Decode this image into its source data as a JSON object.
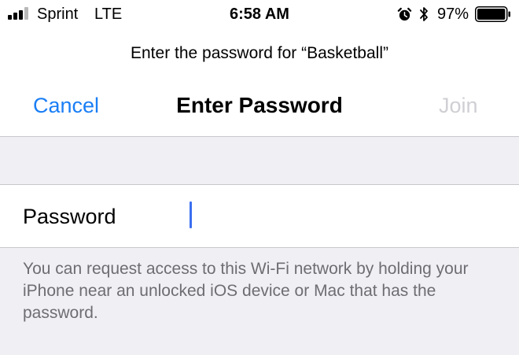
{
  "status_bar": {
    "carrier": "Sprint",
    "network": "LTE",
    "time": "6:58 AM",
    "battery_percent": "97%",
    "battery_level": 0.97,
    "icons": [
      "signal-bars-icon",
      "alarm-icon",
      "bluetooth-icon",
      "battery-icon"
    ]
  },
  "prompt": "Enter the password for “Basketball”",
  "nav": {
    "cancel_label": "Cancel",
    "title": "Enter Password",
    "join_label": "Join"
  },
  "password_field": {
    "label": "Password",
    "value": ""
  },
  "footer_note": "You can request access to this Wi-Fi network by holding your iPhone near an unlocked iOS device or Mac that has the password.",
  "colors": {
    "accent": "#1a7ef5",
    "disabled": "#cfcfd4",
    "caret": "#3b6ff0",
    "background": "#efeff4",
    "secondary_text": "#6d6d72"
  }
}
